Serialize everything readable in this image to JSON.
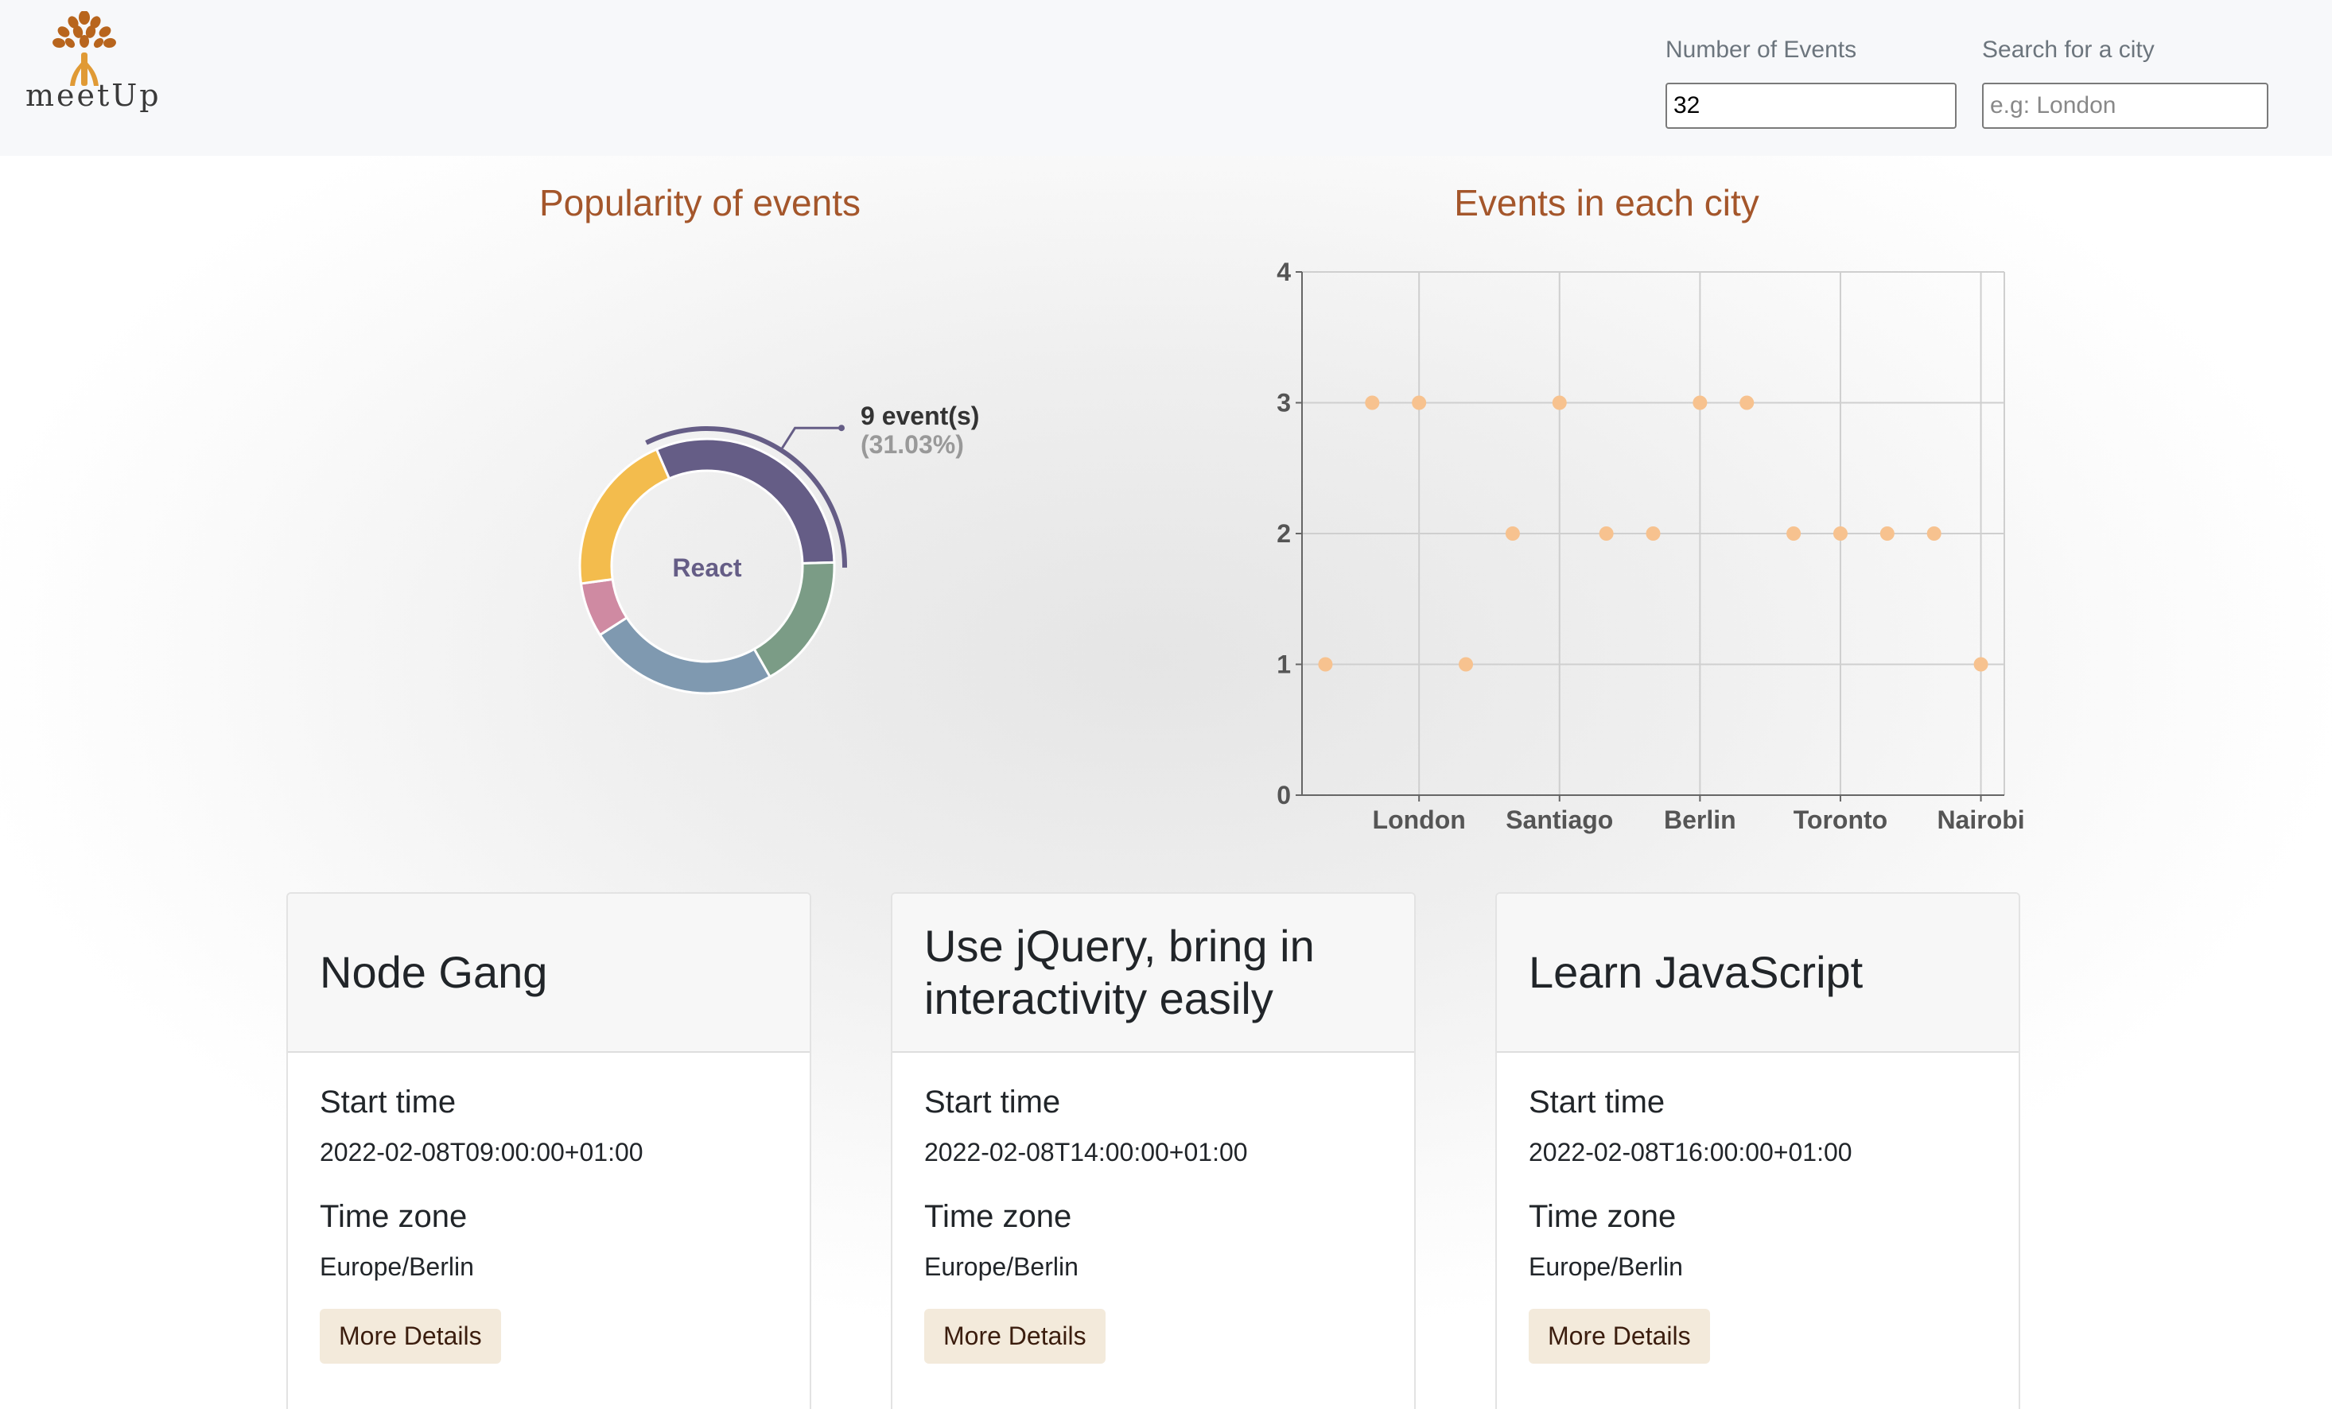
{
  "app": {
    "logo_text": "meetUp"
  },
  "controls": {
    "events_label": "Number of Events",
    "events_value": "32",
    "city_label": "Search for a city",
    "city_placeholder": "e.g: London"
  },
  "charts": {
    "pie_title": "Popularity of events",
    "scatter_title": "Events in each city"
  },
  "chart_data": [
    {
      "type": "pie",
      "title": "Popularity of events",
      "center_label": "React",
      "active_label": "9 event(s)",
      "active_percent": "(31.03%)",
      "slices": [
        {
          "name": "React",
          "value": 9,
          "color": "#655d86"
        },
        {
          "name": "",
          "value": 5,
          "color": "#7b9c86"
        },
        {
          "name": "",
          "value": 7,
          "color": "#7f99b0"
        },
        {
          "name": "",
          "value": 2,
          "color": "#cf8aa2"
        },
        {
          "name": "",
          "value": 6,
          "color": "#f3bc4d"
        }
      ]
    },
    {
      "type": "scatter",
      "title": "Events in each city",
      "ylim": [
        0,
        4
      ],
      "yticks": [
        "0",
        "1",
        "2",
        "3",
        "4"
      ],
      "xticks": [
        "London",
        "Santiago",
        "Berlin",
        "Toronto",
        "Nairobi"
      ],
      "grid": true,
      "point_color": "#f7c28f",
      "points": [
        1,
        3,
        3,
        1,
        2,
        3,
        2,
        2,
        3,
        3,
        2,
        2,
        2,
        2,
        1
      ]
    }
  ],
  "events": [
    {
      "title": "Node Gang",
      "start_label": "Start time",
      "start": "2022-02-08T09:00:00+01:00",
      "tz_label": "Time zone",
      "tz": "Europe/Berlin",
      "button": "More Details"
    },
    {
      "title": "Use jQuery, bring in interactivity easily",
      "start_label": "Start time",
      "start": "2022-02-08T14:00:00+01:00",
      "tz_label": "Time zone",
      "tz": "Europe/Berlin",
      "button": "More Details"
    },
    {
      "title": "Learn JavaScript",
      "start_label": "Start time",
      "start": "2022-02-08T16:00:00+01:00",
      "tz_label": "Time zone",
      "tz": "Europe/Berlin",
      "button": "More Details"
    }
  ]
}
